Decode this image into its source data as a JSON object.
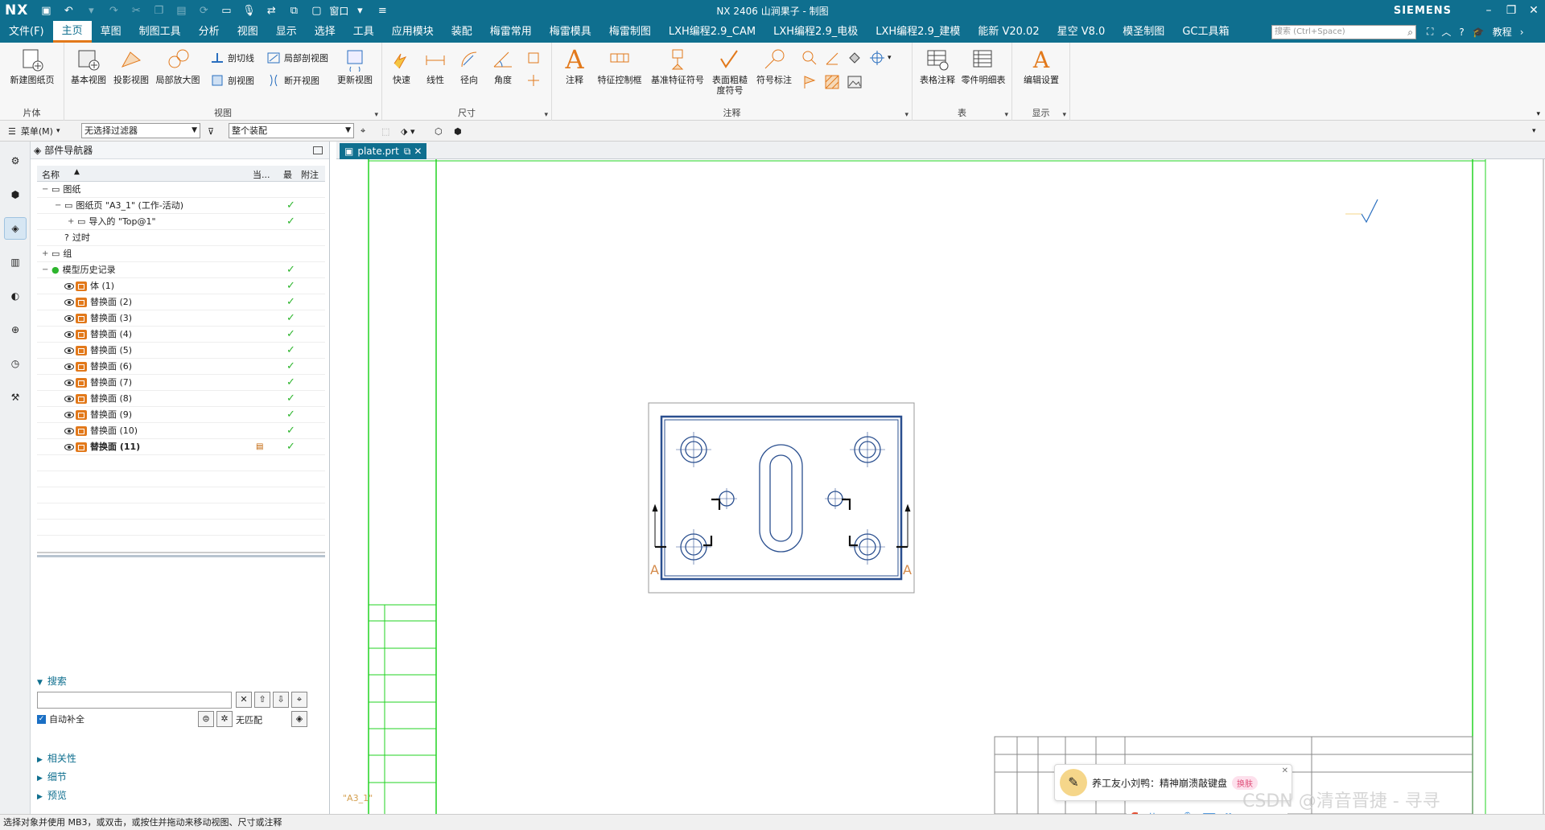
{
  "app": {
    "logo": "NX",
    "window_title": "NX 2406 山涧果子 - 制图",
    "brand": "SIEMENS",
    "window_menu": "窗口"
  },
  "menu": {
    "file": "文件(F)",
    "tabs": [
      "主页",
      "草图",
      "制图工具",
      "分析",
      "视图",
      "显示",
      "选择",
      "工具",
      "应用模块",
      "装配",
      "梅雷常用",
      "梅雷模具",
      "梅雷制图",
      "LXH编程2.9_CAM",
      "LXH编程2.9_电极",
      "LXH编程2.9_建模",
      "能新 V20.02",
      "星空 V8.0",
      "模圣制图",
      "GC工具箱"
    ],
    "active_tab": "主页",
    "search_placeholder": "搜索 (Ctrl+Space)",
    "tutorial": "教程"
  },
  "ribbon": {
    "sheet": {
      "new_sheet": "新建图纸页",
      "label": "片体"
    },
    "view": {
      "base_view": "基本视图",
      "projected_view": "投影视图",
      "detail_view": "局部放大图",
      "section_line": "剖切线",
      "breakout_section": "局部剖视图",
      "section_view": "剖视图",
      "broken_view": "断开视图",
      "update_view": "更新视图",
      "label": "视图"
    },
    "dimension": {
      "rapid": "快速",
      "linear": "线性",
      "radial": "径向",
      "angular": "角度",
      "label": "尺寸"
    },
    "annotation": {
      "note": "注释",
      "fcf": "特征控制框",
      "datum_symbol": "基准特征符号",
      "surface_finish": "表面粗糙度符号",
      "symbol_label": "符号标注",
      "label": "注释"
    },
    "table": {
      "tabular_note": "表格注释",
      "parts_list": "零件明细表",
      "label": "表"
    },
    "display": {
      "edit_settings": "编辑设置",
      "label": "显示"
    }
  },
  "selbar": {
    "menu": "菜单(M)",
    "filter": "无选择过滤器",
    "scope": "整个装配"
  },
  "navigator": {
    "title": "部件导航器",
    "columns": {
      "name": "名称",
      "current": "当...",
      "latest": "最",
      "attach": "附注"
    },
    "rows": [
      {
        "name": "图纸",
        "indent": 0,
        "check": false
      },
      {
        "name": "图纸页 \"A3_1\" (工作-活动)",
        "indent": 1,
        "check": true
      },
      {
        "name": "导入的 \"Top@1\"",
        "indent": 2,
        "check": true
      },
      {
        "name": "过时",
        "indent": 1,
        "check": false
      },
      {
        "name": "组",
        "indent": 0,
        "check": false
      },
      {
        "name": "模型历史记录",
        "indent": 0,
        "check": true
      },
      {
        "name": "体 (1)",
        "indent": 1,
        "check": true
      },
      {
        "name": "替换面 (2)",
        "indent": 1,
        "check": true
      },
      {
        "name": "替换面 (3)",
        "indent": 1,
        "check": true
      },
      {
        "name": "替换面 (4)",
        "indent": 1,
        "check": true
      },
      {
        "name": "替换面 (5)",
        "indent": 1,
        "check": true
      },
      {
        "name": "替换面 (6)",
        "indent": 1,
        "check": true
      },
      {
        "name": "替换面 (7)",
        "indent": 1,
        "check": true
      },
      {
        "name": "替换面 (8)",
        "indent": 1,
        "check": true
      },
      {
        "name": "替换面 (9)",
        "indent": 1,
        "check": true
      },
      {
        "name": "替换面 (10)",
        "indent": 1,
        "check": true
      },
      {
        "name": "替换面 (11)",
        "indent": 1,
        "check": true
      }
    ],
    "search": {
      "title": "搜索",
      "auto_complete": "自动补全",
      "no_match": "无匹配"
    },
    "sections": [
      "相关性",
      "细节",
      "预览"
    ]
  },
  "document": {
    "tab": "plate.prt",
    "sheet_name": "\"A3_1\"",
    "section_letter": "A"
  },
  "status": "选择对象并使用 MB3，或双击，或按住并拖动来移动视图、尺寸或注释",
  "overlay": {
    "chat_text": "养工友小刘鸭：精神崩溃敲键盘",
    "chat_btn": "换肤",
    "ime_lang": "英",
    "watermark": "CSDN @清音晋捷 - 寻寻"
  },
  "colors": {
    "accent": "#0f6f8f",
    "active_underline": "#e2791b",
    "check": "#2db52d",
    "border_green": "#22d322",
    "drawing_blue": "#2a4f8f",
    "section_orange": "#d48a4a"
  }
}
